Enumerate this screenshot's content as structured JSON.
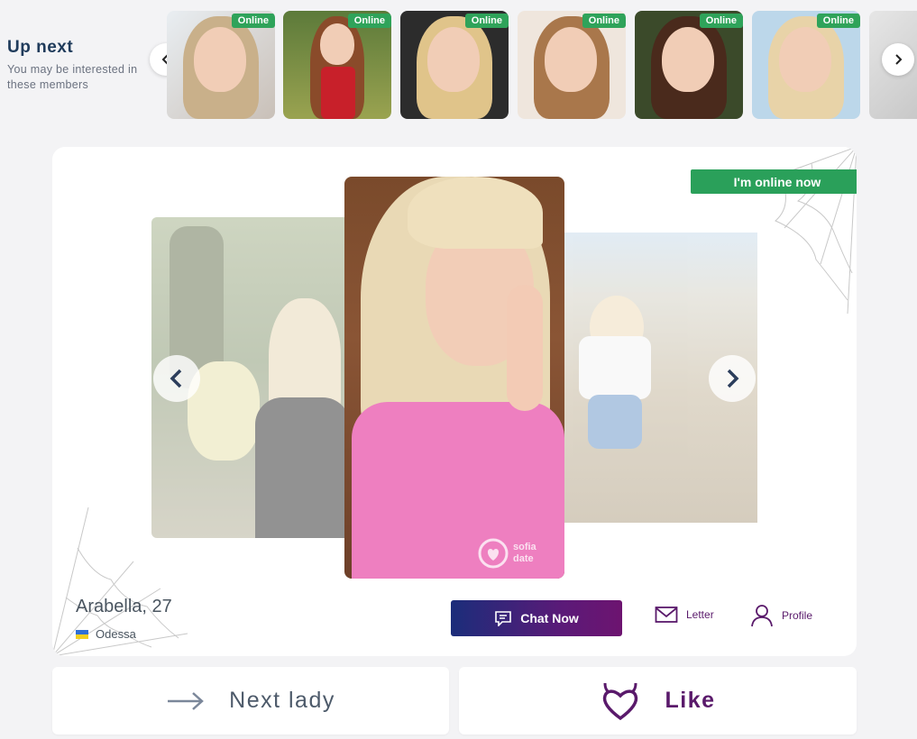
{
  "up_next": {
    "title": "Up next",
    "subtitle": "You may be interested in these members"
  },
  "thumbnails": [
    {
      "badge": "Online"
    },
    {
      "badge": "Online"
    },
    {
      "badge": "Online"
    },
    {
      "badge": "Online"
    },
    {
      "badge": "Online"
    },
    {
      "badge": "Online"
    }
  ],
  "profile": {
    "online_status": "I'm online now",
    "name_age": "Arabella, 27",
    "city": "Odessa",
    "watermark": "sofia date"
  },
  "actions": {
    "chat": "Chat Now",
    "letter": "Letter",
    "profile": "Profile"
  },
  "bottom": {
    "next": "Next lady",
    "like": "Like"
  },
  "colors": {
    "online_green": "#2fa35a",
    "chat_gradient_start": "#1b2d7a",
    "chat_gradient_end": "#6d1470",
    "brand_purple": "#5a1a6b",
    "title_navy": "#1f3b5b"
  },
  "icons": [
    "chevron-left-icon",
    "chevron-right-icon",
    "chat-icon",
    "envelope-icon",
    "user-icon",
    "arrow-right-icon",
    "devil-heart-icon"
  ]
}
